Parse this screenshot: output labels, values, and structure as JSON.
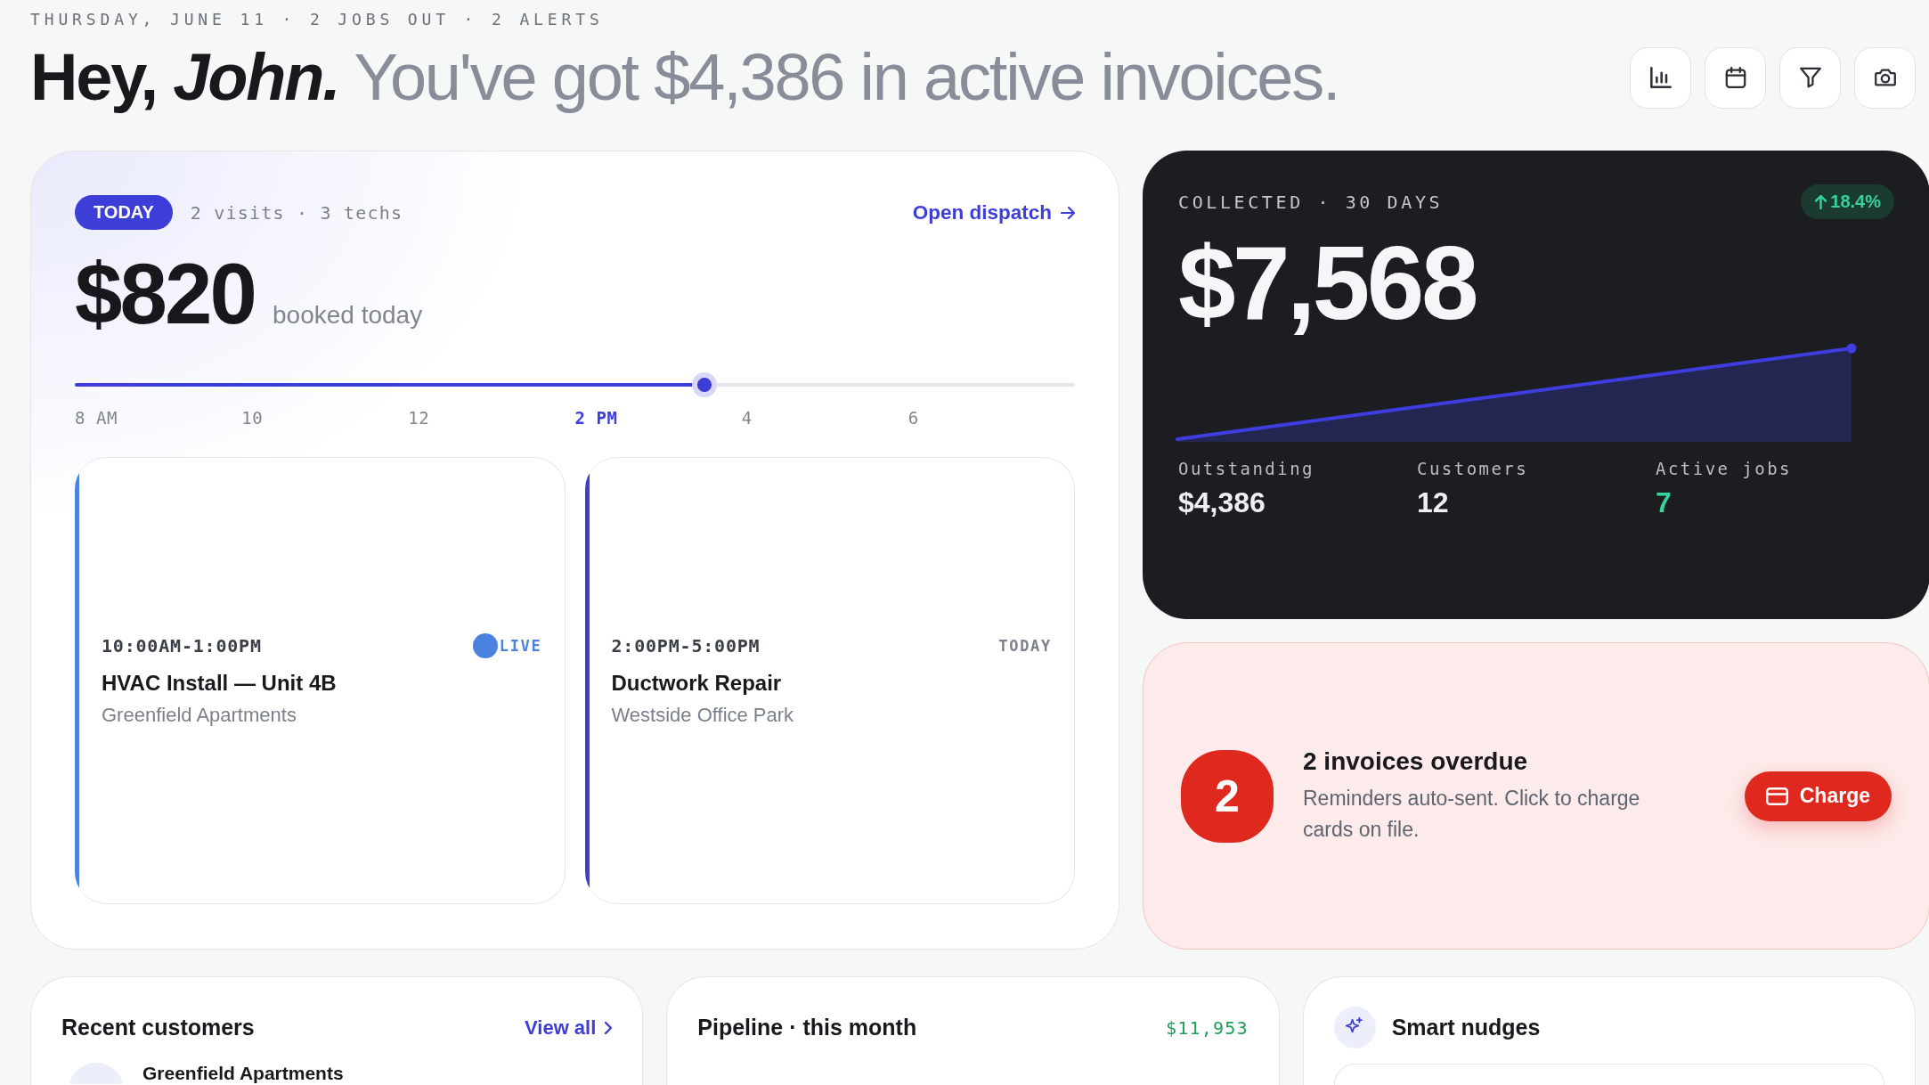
{
  "header": {
    "eyebrow": "THURSDAY, JUNE 11 · 2 JOBS OUT · 2 ALERTS",
    "headline": "**Hey,** *John.* You've got $4,386 in active invoices.",
    "actions": [
      {
        "kind": "stats"
      },
      {
        "kind": "calendar"
      },
      {
        "kind": "filter"
      },
      {
        "kind": "camera"
      }
    ]
  },
  "today": {
    "badge": "TODAY",
    "summary": "2 visits · 3 techs",
    "link": "Open dispatch",
    "amount": "$820",
    "amount_caption": "booked today",
    "timeline": {
      "level": 0.63,
      "ticks": [
        {
          "label": "8 AM",
          "selected": false
        },
        {
          "label": "10",
          "selected": false
        },
        {
          "label": "12",
          "selected": false
        },
        {
          "label": "2 PM",
          "selected": true
        },
        {
          "label": "4",
          "selected": false
        },
        {
          "label": "6",
          "selected": false
        }
      ]
    },
    "jobs": [
      {
        "time": "10:00AM-1:00PM",
        "status": "LIVE",
        "live": true,
        "title": "HVAC Install — Unit 4B",
        "place": "Greenfield Apartments",
        "color": "#4b82e0"
      },
      {
        "time": "2:00PM-5:00PM",
        "status": "TODAY",
        "live": false,
        "title": "Ductwork Repair",
        "place": "Westside Office Park",
        "color": "#3d3dd8"
      }
    ]
  },
  "collected": {
    "label": "COLLECTED · 30 DAYS",
    "change": "18.4%",
    "amount": "$7,568",
    "stats": [
      {
        "label": "Outstanding",
        "value": "$4,386",
        "color": "#eef0f3"
      },
      {
        "label": "Customers",
        "value": "12",
        "color": "#eef0f3"
      },
      {
        "label": "Active jobs",
        "value": "7",
        "color": "#34d399"
      }
    ]
  },
  "overdue": {
    "count": "2",
    "title": "2 invoices overdue",
    "description": "Reminders auto-sent. Click to charge cards on file.",
    "button": "Charge"
  },
  "recent_customers": {
    "title": "Recent customers",
    "link": "View all",
    "customers": [
      {
        "name": "Greenfield Apartments"
      }
    ]
  },
  "pipeline": {
    "title": "Pipeline · this month",
    "total": "$11,953"
  },
  "smart_nudges": {
    "title": "Smart nudges"
  }
}
